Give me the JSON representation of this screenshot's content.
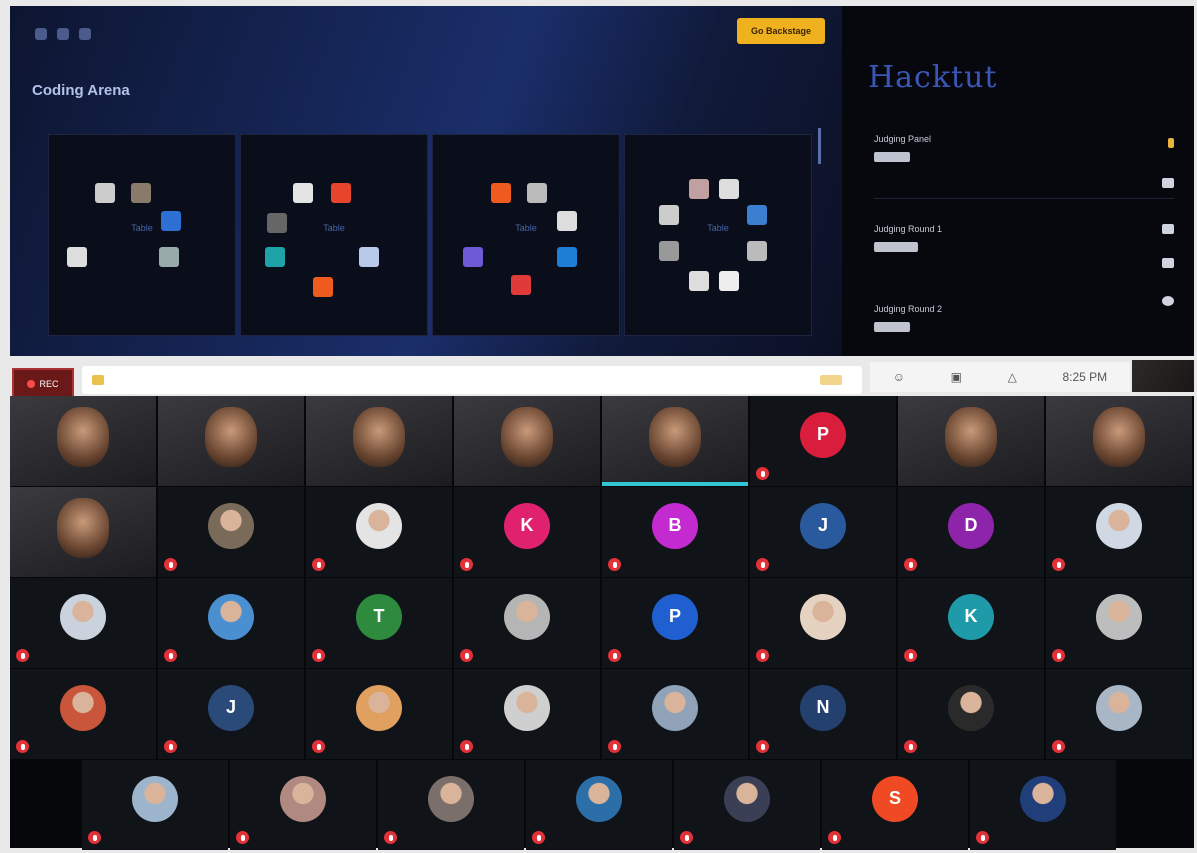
{
  "shared_screen": {
    "join_button_label": "Go Backstage",
    "arena_title": "Coding Arena",
    "rooms": [
      {
        "table": "Table",
        "name": ""
      },
      {
        "table": "Table",
        "name": ""
      },
      {
        "table": "Table",
        "name": ""
      },
      {
        "table": "Table",
        "name": ""
      }
    ],
    "sidebar": {
      "logo_text": "Hacktut",
      "sections": [
        "Judging Panel",
        "Judging Round 1",
        "Judging Round 2"
      ]
    }
  },
  "recording": {
    "label": "REC"
  },
  "top_right": {
    "time": "8:25 PM"
  },
  "participants": [
    {
      "name": "",
      "type": "video",
      "speaking": false
    },
    {
      "name": "",
      "type": "video",
      "speaking": false
    },
    {
      "name": "",
      "type": "video",
      "speaking": false
    },
    {
      "name": "",
      "type": "video",
      "speaking": false
    },
    {
      "name": "",
      "type": "video",
      "speaking": true
    },
    {
      "name": "",
      "type": "initial",
      "initial": "P",
      "color": "#d81e3c"
    },
    {
      "name": "",
      "type": "video",
      "speaking": false
    },
    {
      "name": "",
      "type": "video",
      "speaking": false
    },
    {
      "name": "",
      "type": "video",
      "speaking": false
    },
    {
      "name": "",
      "type": "photo",
      "color": "#7a6a5a"
    },
    {
      "name": "",
      "type": "photo",
      "color": "#e4e4e4"
    },
    {
      "name": "",
      "type": "initial",
      "initial": "K",
      "color": "#e0226e"
    },
    {
      "name": "",
      "type": "initial",
      "initial": "B",
      "color": "#c32bd0"
    },
    {
      "name": "",
      "type": "initial",
      "initial": "J",
      "color": "#2a5a9e"
    },
    {
      "name": "",
      "type": "initial",
      "initial": "D",
      "color": "#8e24aa"
    },
    {
      "name": "",
      "type": "photo",
      "color": "#d0d8e4"
    },
    {
      "name": "",
      "type": "photo",
      "color": "#c9d2dd"
    },
    {
      "name": "",
      "type": "photo",
      "color": "#4a90d0"
    },
    {
      "name": "",
      "type": "initial",
      "initial": "T",
      "color": "#2e8b3d"
    },
    {
      "name": "",
      "type": "photo",
      "color": "#b5b5b5"
    },
    {
      "name": "",
      "type": "initial",
      "initial": "P",
      "color": "#1f5fd0"
    },
    {
      "name": "",
      "type": "photo",
      "color": "#e6d2c0"
    },
    {
      "name": "",
      "type": "initial",
      "initial": "K",
      "color": "#1f9aa8"
    },
    {
      "name": "",
      "type": "photo",
      "color": "#bdbdbd"
    },
    {
      "name": "",
      "type": "photo",
      "color": "#c9563a"
    },
    {
      "name": "",
      "type": "initial",
      "initial": "J",
      "color": "#2a4a7a"
    },
    {
      "name": "",
      "type": "photo",
      "color": "#e0a060"
    },
    {
      "name": "",
      "type": "photo",
      "color": "#cfcfcf"
    },
    {
      "name": "",
      "type": "photo",
      "color": "#8fa2b8"
    },
    {
      "name": "",
      "type": "initial",
      "initial": "N",
      "color": "#24406e"
    },
    {
      "name": "",
      "type": "photo",
      "color": "#2a2a2a"
    },
    {
      "name": "",
      "type": "photo",
      "color": "#a9b6c6"
    },
    {
      "name": "",
      "type": "photo",
      "color": "#9db5cc"
    },
    {
      "name": "",
      "type": "photo",
      "color": "#b08a80"
    },
    {
      "name": "",
      "type": "photo",
      "color": "#7a6f6a"
    },
    {
      "name": "",
      "type": "photo",
      "color": "#2c6ea8"
    },
    {
      "name": "",
      "type": "photo",
      "color": "#3a3f55"
    },
    {
      "name": "",
      "type": "initial",
      "initial": "S",
      "color": "#ef4a24"
    },
    {
      "name": "",
      "type": "photo",
      "color": "#1f3e7a"
    }
  ]
}
